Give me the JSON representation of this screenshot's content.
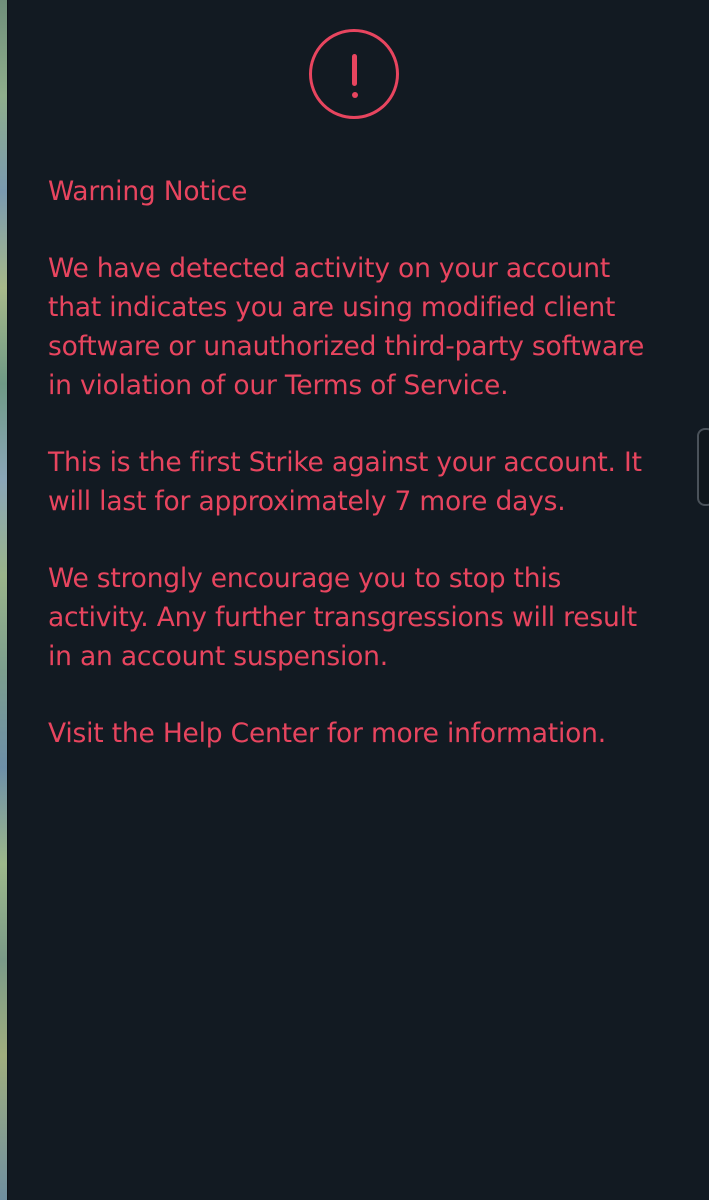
{
  "colors": {
    "background": "#121a22",
    "warning_text": "#e8455f"
  },
  "icon": {
    "name": "exclamation-circle-icon"
  },
  "notice": {
    "title": "Warning Notice",
    "paragraph1": {
      "before_link": "We have detected activity on your account that indicates you are using modified client software or unauthorized third-party software in violation of our ",
      "link": "Terms of Service",
      "after_link": "."
    },
    "paragraph2": "This is the first Strike against your account. It will last for approximately 7 more days.",
    "paragraph3": "We strongly encourage you to stop this activity. Any further transgressions will result in an account suspension.",
    "paragraph4": {
      "before_link": "Visit the ",
      "link": "Help Center",
      "after_link": " for more information."
    }
  }
}
